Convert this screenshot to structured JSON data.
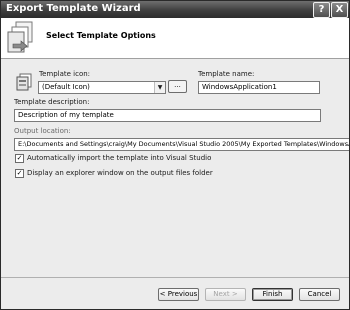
{
  "window": {
    "title": "Export Template Wizard",
    "help_label": "?",
    "close_label": "X"
  },
  "header": {
    "title": "Select Template Options"
  },
  "form": {
    "icon_label": "Template icon:",
    "icon_value": "(Default Icon)",
    "browse_label": "...",
    "name_label": "Template name:",
    "name_value": "WindowsApplication1",
    "description_label": "Template description:",
    "description_value": "Description of my template",
    "output_label": "Output location:",
    "output_value": "E:\\Documents and Settings\\craig\\My Documents\\Visual Studio 2005\\My Exported Templates\\WindowsApplicat"
  },
  "options": [
    {
      "label": "Automatically import the template into Visual Studio",
      "checked": true
    },
    {
      "label": "Display an explorer window on the output files folder",
      "checked": true
    }
  ],
  "buttons": {
    "previous": "< Previous",
    "next": "Next >",
    "finish": "Finish",
    "cancel": "Cancel"
  },
  "icons": {
    "header": "document-export-icon",
    "template": "template-icon",
    "dropdown": "chevron-down-icon",
    "check": "checkmark-icon"
  },
  "colors": {
    "titlebar": "#3a3a3a",
    "window_bg": "#ececec",
    "header_bg": "#ffffff"
  }
}
